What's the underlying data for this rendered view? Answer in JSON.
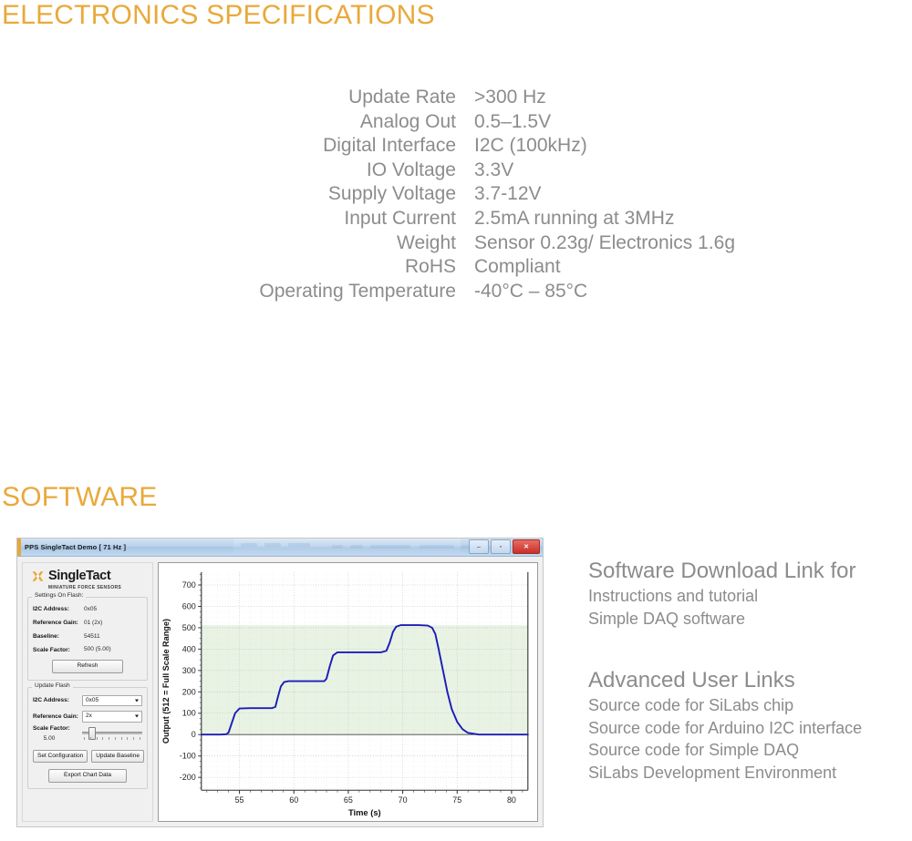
{
  "headings": {
    "electronics": "ELECTRONICS SPECIFICATIONS",
    "software": "SOFTWARE",
    "accent_color": "#E9A93B"
  },
  "specs": {
    "rows": [
      {
        "label": "Update Rate",
        "value": ">300 Hz"
      },
      {
        "label": "Analog Out",
        "value": "0.5–1.5V"
      },
      {
        "label": "Digital Interface",
        "value": "I2C (100kHz)"
      },
      {
        "label": "IO Voltage",
        "value": "3.3V"
      },
      {
        "label": "Supply Voltage",
        "value": "3.7-12V"
      },
      {
        "label": "Input Current",
        "value": "2.5mA  running at 3MHz"
      },
      {
        "label": "Weight",
        "value": "Sensor 0.23g/ Electronics 1.6g"
      },
      {
        "label": "RoHS",
        "value": "Compliant"
      },
      {
        "label": "Operating Temperature",
        "value": "-40°C – 85°C"
      }
    ]
  },
  "app": {
    "titlebar": {
      "title": "PPS SingleTact Demo [ 71 Hz ]",
      "minimize_glyph": "–",
      "maximize_glyph": "▫",
      "close_glyph": "✕"
    },
    "logo": {
      "wordmark": "SingleTact",
      "tagline": "MINIATURE FORCE SENSORS",
      "mark_color": "#E9A93B"
    },
    "settings_on_flash": {
      "group_title": "Settings On Flash:",
      "fields": [
        {
          "label": "I2C Address:",
          "value": "0x05"
        },
        {
          "label": "Reference Gain:",
          "value": "01 (2x)"
        },
        {
          "label": "Baseline:",
          "value": "54511"
        },
        {
          "label": "Scale Factor:",
          "value": "500 (5.00)"
        }
      ],
      "refresh_label": "Refresh"
    },
    "update_flash": {
      "group_title": "Update Flash",
      "fields": [
        {
          "label": "I2C Address:",
          "value": "0x05"
        },
        {
          "label": "Reference Gain:",
          "value": "2x"
        }
      ],
      "scale_factor_label": "Scale Factor:",
      "scale_factor_value": "5.00",
      "set_configuration_label": "Set Configuration",
      "update_baseline_label": "Update Baseline",
      "export_chart_data_label": "Export Chart Data"
    }
  },
  "chart_data": {
    "type": "line",
    "title": "",
    "xlabel": "Time (s)",
    "ylabel": "Output (512 = Full Scale Range)",
    "xlim": [
      51.5,
      81.5
    ],
    "ylim": [
      -260,
      760
    ],
    "xticks": [
      55,
      60,
      65,
      70,
      75,
      80
    ],
    "yticks": [
      -200,
      -100,
      0,
      100,
      200,
      300,
      400,
      500,
      600,
      700
    ],
    "grid": true,
    "legend": "none",
    "series": [
      {
        "name": "Output",
        "color": "#1d1db5",
        "x": [
          51.5,
          52.5,
          53.3,
          53.8,
          54.0,
          54.3,
          54.6,
          55.0,
          56.0,
          57.0,
          58.0,
          58.3,
          58.5,
          58.8,
          59.1,
          59.5,
          60.0,
          61.0,
          62.0,
          62.8,
          63.0,
          63.3,
          63.6,
          64.0,
          65.0,
          66.0,
          67.0,
          68.0,
          68.5,
          68.8,
          69.1,
          69.4,
          69.8,
          70.5,
          71.5,
          72.3,
          72.7,
          73.0,
          73.3,
          73.7,
          74.1,
          74.5,
          75.0,
          75.5,
          76.0,
          77.0,
          78.0,
          79.0,
          80.0,
          81.0,
          81.5
        ],
        "y": [
          0,
          0,
          0,
          2,
          10,
          55,
          100,
          122,
          124,
          124,
          124,
          130,
          170,
          225,
          246,
          250,
          250,
          250,
          250,
          250,
          262,
          320,
          370,
          385,
          385,
          385,
          385,
          385,
          392,
          430,
          480,
          505,
          512,
          512,
          512,
          510,
          500,
          470,
          400,
          300,
          200,
          120,
          60,
          25,
          8,
          0,
          0,
          0,
          0,
          0,
          0
        ]
      }
    ],
    "shaded_band": {
      "from": 0,
      "to": 512,
      "color": "#e8f3e4",
      "label": "full scale range band"
    },
    "zero_line": {
      "y": 0,
      "color": "#404040"
    }
  },
  "links": {
    "download": {
      "title": "Software Download Link for",
      "items": [
        "Instructions and tutorial",
        "Simple DAQ software"
      ]
    },
    "advanced": {
      "title": "Advanced User Links",
      "items": [
        "Source code for SiLabs chip",
        "Source code for Arduino I2C interface",
        "Source code for Simple DAQ",
        "SiLabs Development Environment"
      ]
    }
  }
}
